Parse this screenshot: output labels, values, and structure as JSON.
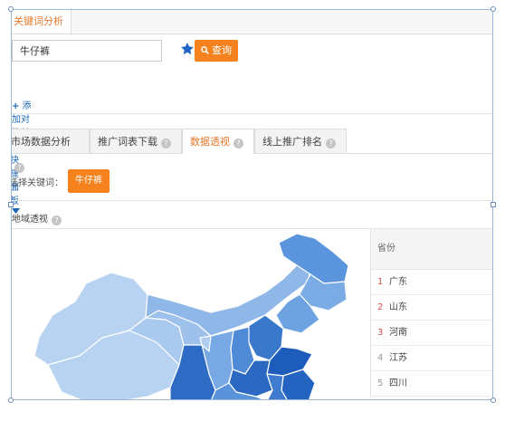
{
  "window": {
    "tab_title": "关键词分析"
  },
  "search": {
    "value": "牛仔裤",
    "query_label": "查询"
  },
  "links": {
    "add_compare": "添加对比关键词",
    "expand_panel": "展开快捷面板"
  },
  "subtabs": [
    {
      "label": "市场数据分析"
    },
    {
      "label": "推广词表下载"
    },
    {
      "label": "数据透视"
    },
    {
      "label": "线上推广排名"
    }
  ],
  "keyword_select": {
    "label": "选择关键词：",
    "chip": "牛仔裤"
  },
  "region": {
    "title": "地域透视"
  },
  "table": {
    "header": "省份",
    "rows": [
      {
        "rank": "1",
        "province": "广东"
      },
      {
        "rank": "2",
        "province": "山东"
      },
      {
        "rank": "3",
        "province": "河南"
      },
      {
        "rank": "4",
        "province": "江苏"
      },
      {
        "rank": "5",
        "province": "四川"
      }
    ]
  },
  "colors": {
    "accent": "#f5821f",
    "link": "#1a66b8",
    "map_light": "#b3cff0",
    "map_mid": "#6aa0e0",
    "map_dark": "#1f5fbf"
  }
}
